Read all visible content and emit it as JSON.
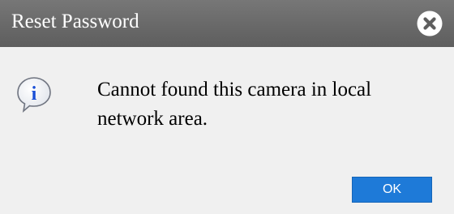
{
  "dialog": {
    "title": "Reset Password",
    "close_icon": "close-circle-icon",
    "info_icon": "info-icon",
    "message": "Cannot found this camera in local network area.",
    "ok_label": "OK"
  },
  "colors": {
    "titlebar": "#6a6a6a",
    "body_background": "#f0f0f0",
    "ok_button": "#1e7ad8",
    "info_letter": "#1a4fd6"
  }
}
